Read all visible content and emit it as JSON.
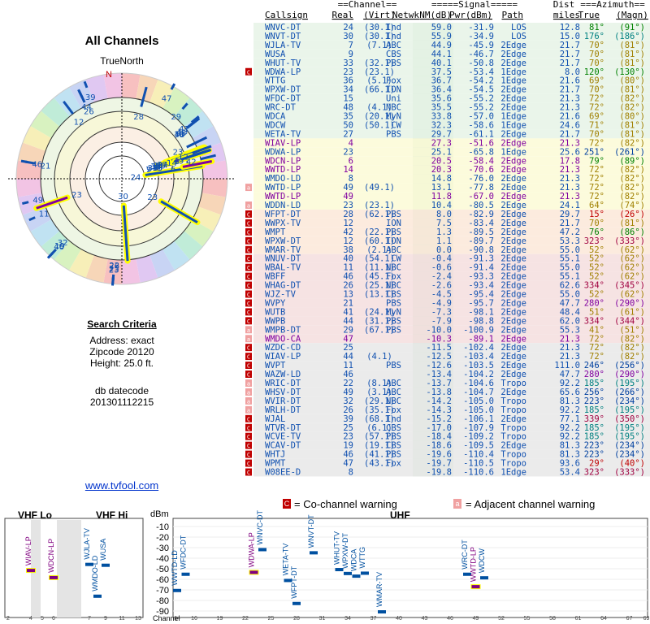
{
  "left": {
    "title": "All Channels",
    "north_label": "TrueNorth",
    "compass_n": "N",
    "search_heading": "Search Criteria",
    "address": "Address: exact",
    "zipcode": "Zipcode 20120",
    "height": "Height: 25.0 ft.",
    "db_label": "db datecode",
    "db_code": "201301112215",
    "link": "www.tvfool.com"
  },
  "table": {
    "group_headers": {
      "channel": "==Channel==",
      "signal": "=====Signal=====",
      "dist": "Dist",
      "azimuth": "===Azimuth=="
    },
    "columns": [
      "Callsign",
      "Real",
      "(Virt)",
      "Netwk",
      "NM(dB)",
      "Pwr(dBm)",
      "Path",
      "miles",
      "True",
      "(Magn)"
    ],
    "rows": [
      [
        "",
        "WNVC-DT",
        "24",
        "(30.1)",
        "Ind",
        "59.0",
        "-31.9",
        "LOS",
        "12.8",
        "81°",
        "(91°)"
      ],
      [
        "",
        "WNVT-DT",
        "30",
        "(30.1)",
        "Ind",
        "55.9",
        "-34.9",
        "LOS",
        "15.0",
        "176°",
        "(186°)"
      ],
      [
        "",
        "WJLA-TV",
        "7",
        "(7.1)",
        "ABC",
        "44.9",
        "-45.9",
        "2Edge",
        "21.7",
        "70°",
        "(81°)"
      ],
      [
        "",
        "WUSA",
        "9",
        "",
        "CBS",
        "44.1",
        "-46.7",
        "2Edge",
        "21.7",
        "70°",
        "(81°)"
      ],
      [
        "",
        "WHUT-TV",
        "33",
        "(32.1)",
        "PBS",
        "40.1",
        "-50.8",
        "2Edge",
        "21.7",
        "70°",
        "(81°)"
      ],
      [
        "C",
        "WDWA-LP",
        "23",
        "(23.1)",
        "",
        "37.5",
        "-53.4",
        "1Edge",
        "8.0",
        "120°",
        "(130°)"
      ],
      [
        "",
        "WTTG",
        "36",
        "(5.1)",
        "Fox",
        "36.7",
        "-54.2",
        "1Edge",
        "21.6",
        "69°",
        "(80°)"
      ],
      [
        "",
        "WPXW-DT",
        "34",
        "(66.1)",
        "ION",
        "36.4",
        "-54.5",
        "2Edge",
        "21.7",
        "70°",
        "(81°)"
      ],
      [
        "",
        "WFDC-DT",
        "15",
        "",
        "Uni",
        "35.6",
        "-55.2",
        "2Edge",
        "21.3",
        "72°",
        "(82°)"
      ],
      [
        "",
        "WRC-DT",
        "48",
        "(4.1)",
        "NBC",
        "35.5",
        "-55.2",
        "2Edge",
        "21.3",
        "72°",
        "(82°)"
      ],
      [
        "",
        "WDCA",
        "35",
        "(20.1)",
        "MyN",
        "33.8",
        "-57.0",
        "1Edge",
        "21.6",
        "69°",
        "(80°)"
      ],
      [
        "",
        "WDCW",
        "50",
        "(50.1)",
        "CW",
        "32.3",
        "-58.6",
        "1Edge",
        "24.6",
        "71°",
        "(81°)"
      ],
      [
        "",
        "WETA-TV",
        "27",
        "",
        "PBS",
        "29.7",
        "-61.1",
        "2Edge",
        "21.7",
        "70°",
        "(81°)"
      ],
      [
        "",
        "WIAV-LP",
        "4",
        "",
        "",
        "27.3",
        "-51.6",
        "2Edge",
        "21.3",
        "72°",
        "(82°)"
      ],
      [
        "",
        "WDWA-LP",
        "23",
        "",
        "",
        "25.1",
        "-65.8",
        "1Edge",
        "25.6",
        "251°",
        "(261°)"
      ],
      [
        "",
        "WDCN-LP",
        "6",
        "",
        "",
        "20.5",
        "-58.4",
        "2Edge",
        "17.8",
        "79°",
        "(89°)"
      ],
      [
        "",
        "WWTD-LP",
        "14",
        "",
        "",
        "20.3",
        "-70.6",
        "2Edge",
        "21.3",
        "72°",
        "(82°)"
      ],
      [
        "",
        "WMDO-LD",
        "8",
        "",
        "",
        "14.8",
        "-76.0",
        "2Edge",
        "21.3",
        "72°",
        "(82°)"
      ],
      [
        "a",
        "WWTD-LP",
        "49",
        "(49.1)",
        "",
        "13.1",
        "-77.8",
        "2Edge",
        "21.3",
        "72°",
        "(82°)"
      ],
      [
        "",
        "WWTD-LP",
        "49",
        "",
        "",
        "11.8",
        "-67.0",
        "2Edge",
        "21.3",
        "72°",
        "(82°)"
      ],
      [
        "a",
        "WDDN-LD",
        "23",
        "(23.1)",
        "",
        "10.4",
        "-80.5",
        "2Edge",
        "24.1",
        "64°",
        "(74°)"
      ],
      [
        "C",
        "WFPT-DT",
        "28",
        "(62.1)",
        "PBS",
        "8.0",
        "-82.9",
        "2Edge",
        "29.7",
        "15°",
        "(26°)"
      ],
      [
        "C",
        "WWPX-TV",
        "12",
        "",
        "ION",
        "7.5",
        "-83.4",
        "2Edge",
        "21.7",
        "70°",
        "(81°)"
      ],
      [
        "C",
        "WMPT",
        "42",
        "(22.1)",
        "PBS",
        "1.3",
        "-89.5",
        "2Edge",
        "47.2",
        "76°",
        "(86°)"
      ],
      [
        "C",
        "WPXW-DT",
        "12",
        "(60.1)",
        "ION",
        "1.1",
        "-89.7",
        "2Edge",
        "53.3",
        "323°",
        "(333°)"
      ],
      [
        "C",
        "WMAR-TV",
        "38",
        "(2.1)",
        "ABC",
        "0.0",
        "-90.8",
        "2Edge",
        "55.0",
        "52°",
        "(62°)"
      ],
      [
        "C",
        "WNUV-DT",
        "40",
        "(54.1)",
        "CW",
        "-0.4",
        "-91.3",
        "2Edge",
        "55.1",
        "52°",
        "(62°)"
      ],
      [
        "C",
        "WBAL-TV",
        "11",
        "(11.1)",
        "NBC",
        "-0.6",
        "-91.4",
        "2Edge",
        "55.0",
        "52°",
        "(62°)"
      ],
      [
        "C",
        "WBFF",
        "46",
        "(45.1)",
        "Fox",
        "-2.4",
        "-93.3",
        "2Edge",
        "55.1",
        "52°",
        "(62°)"
      ],
      [
        "C",
        "WHAG-DT",
        "26",
        "(25.1)",
        "NBC",
        "-2.6",
        "-93.4",
        "2Edge",
        "62.6",
        "334°",
        "(345°)"
      ],
      [
        "C",
        "WJZ-TV",
        "13",
        "(13.1)",
        "CBS",
        "-4.5",
        "-95.4",
        "2Edge",
        "55.0",
        "52°",
        "(62°)"
      ],
      [
        "C",
        "WVPY",
        "21",
        "",
        "PBS",
        "-4.9",
        "-95.7",
        "2Edge",
        "47.7",
        "280°",
        "(290°)"
      ],
      [
        "C",
        "WUTB",
        "41",
        "(24.1)",
        "MyN",
        "-7.3",
        "-98.1",
        "2Edge",
        "48.4",
        "51°",
        "(61°)"
      ],
      [
        "C",
        "WWPB",
        "44",
        "(31.1)",
        "PBS",
        "-7.9",
        "-98.8",
        "2Edge",
        "62.0",
        "334°",
        "(344°)"
      ],
      [
        "a",
        "WMPB-DT",
        "29",
        "(67.1)",
        "PBS",
        "-10.0",
        "-100.9",
        "2Edge",
        "55.3",
        "41°",
        "(51°)"
      ],
      [
        "a",
        "WMDO-CA",
        "47",
        "",
        "",
        "-10.3",
        "-89.1",
        "2Edge",
        "21.3",
        "72°",
        "(82°)"
      ],
      [
        "C",
        "WZDC-CD",
        "25",
        "",
        "",
        "-11.5",
        "-102.4",
        "2Edge",
        "21.3",
        "72°",
        "(82°)"
      ],
      [
        "C",
        "WIAV-LP",
        "44",
        "(4.1)",
        "",
        "-12.5",
        "-103.4",
        "2Edge",
        "21.3",
        "72°",
        "(82°)"
      ],
      [
        "C",
        "WVPT",
        "11",
        "",
        "PBS",
        "-12.6",
        "-103.5",
        "2Edge",
        "111.0",
        "246°",
        "(256°)"
      ],
      [
        "C",
        "WAZW-LD",
        "46",
        "",
        "",
        "-13.4",
        "-104.2",
        "2Edge",
        "47.7",
        "280°",
        "(290°)"
      ],
      [
        "a",
        "WRIC-DT",
        "22",
        "(8.1)",
        "ABC",
        "-13.7",
        "-104.6",
        "Tropo",
        "92.2",
        "185°",
        "(195°)"
      ],
      [
        "a",
        "WHSV-DT",
        "49",
        "(3.1)",
        "ABC",
        "-13.8",
        "-104.7",
        "2Edge",
        "65.6",
        "256°",
        "(266°)"
      ],
      [
        "a",
        "WVIR-DT",
        "32",
        "(29.1)",
        "NBC",
        "-14.2",
        "-105.0",
        "Tropo",
        "81.3",
        "223°",
        "(234°)"
      ],
      [
        "a",
        "WRLH-DT",
        "26",
        "(35.1)",
        "Fox",
        "-14.3",
        "-105.0",
        "Tropo",
        "92.2",
        "185°",
        "(195°)"
      ],
      [
        "C",
        "WJAL",
        "39",
        "(68.1)",
        "Ind",
        "-15.2",
        "-106.1",
        "2Edge",
        "77.1",
        "339°",
        "(350°)"
      ],
      [
        "C",
        "WTVR-DT",
        "25",
        "(6.1)",
        "CBS",
        "-17.0",
        "-107.9",
        "Tropo",
        "92.2",
        "185°",
        "(195°)"
      ],
      [
        "C",
        "WCVE-TV",
        "23",
        "(57.1)",
        "PBS",
        "-18.4",
        "-109.2",
        "Tropo",
        "92.2",
        "185°",
        "(195°)"
      ],
      [
        "C",
        "WCAV-DT",
        "19",
        "(19.1)",
        "CBS",
        "-18.6",
        "-109.5",
        "2Edge",
        "81.3",
        "223°",
        "(234°)"
      ],
      [
        "C",
        "WHTJ",
        "46",
        "(41.1)",
        "PBS",
        "-19.6",
        "-110.4",
        "Tropo",
        "81.3",
        "223°",
        "(234°)"
      ],
      [
        "C",
        "WPMT",
        "47",
        "(43.1)",
        "Fox",
        "-19.7",
        "-110.5",
        "Tropo",
        "93.6",
        "29°",
        "(40°)"
      ],
      [
        "C",
        "W08EE-D",
        "8",
        "",
        "",
        "-19.8",
        "-110.6",
        "1Edge",
        "53.4",
        "323°",
        "(333°)"
      ]
    ]
  },
  "legend": {
    "co_icon": "C",
    "co_text": "= Co-channel warning",
    "adj_icon": "a",
    "adj_text": "= Adjacent channel warning"
  },
  "bottom_chart": {
    "vhf_lo": "VHF Lo",
    "vhf_hi": "VHF Hi",
    "uhf": "UHF",
    "dbm": "dBm",
    "channel_label": "Channel"
  },
  "chart_data": [
    {
      "type": "scatter",
      "title": "All Channels",
      "xlabel": "",
      "ylabel": "",
      "description_of_axes": "polar azimuth degrees vs signal margin",
      "points": [
        {
          "label": "24",
          "azimuth": 81,
          "nm": 59.0
        },
        {
          "label": "30",
          "azimuth": 176,
          "nm": 55.9
        },
        {
          "label": "7",
          "azimuth": 70,
          "nm": 44.9
        },
        {
          "label": "9",
          "azimuth": 70,
          "nm": 44.1
        },
        {
          "label": "33",
          "azimuth": 70,
          "nm": 40.1
        },
        {
          "label": "23",
          "azimuth": 120,
          "nm": 37.5
        },
        {
          "label": "36",
          "azimuth": 69,
          "nm": 36.7
        },
        {
          "label": "34",
          "azimuth": 70,
          "nm": 36.4
        },
        {
          "label": "15",
          "azimuth": 72,
          "nm": 35.6
        },
        {
          "label": "48",
          "azimuth": 72,
          "nm": 35.5
        },
        {
          "label": "35",
          "azimuth": 69,
          "nm": 33.8
        },
        {
          "label": "50",
          "azimuth": 71,
          "nm": 32.3
        },
        {
          "label": "27",
          "azimuth": 70,
          "nm": 29.7
        },
        {
          "label": "4",
          "azimuth": 72,
          "nm": 27.3
        },
        {
          "label": "23",
          "azimuth": 251,
          "nm": 25.1
        },
        {
          "label": "6",
          "azimuth": 79,
          "nm": 20.5
        },
        {
          "label": "14",
          "azimuth": 72,
          "nm": 20.3
        },
        {
          "label": "8",
          "azimuth": 72,
          "nm": 14.8
        },
        {
          "label": "49",
          "azimuth": 72,
          "nm": 13.1
        },
        {
          "label": "23",
          "azimuth": 64,
          "nm": 10.4
        },
        {
          "label": "28",
          "azimuth": 15,
          "nm": 8.0
        },
        {
          "label": "12",
          "azimuth": 70,
          "nm": 7.5
        },
        {
          "label": "42",
          "azimuth": 76,
          "nm": 1.3
        },
        {
          "label": "12",
          "azimuth": 323,
          "nm": 1.1
        },
        {
          "label": "38",
          "azimuth": 52,
          "nm": 0.0
        },
        {
          "label": "40",
          "azimuth": 52,
          "nm": -0.4
        },
        {
          "label": "11",
          "azimuth": 52,
          "nm": -0.6
        },
        {
          "label": "46",
          "azimuth": 52,
          "nm": -2.4
        },
        {
          "label": "26",
          "azimuth": 334,
          "nm": -2.6
        },
        {
          "label": "13",
          "azimuth": 52,
          "nm": -4.5
        },
        {
          "label": "21",
          "azimuth": 280,
          "nm": -4.9
        },
        {
          "label": "41",
          "azimuth": 51,
          "nm": -7.3
        },
        {
          "label": "44",
          "azimuth": 334,
          "nm": -7.9
        },
        {
          "label": "29",
          "azimuth": 41,
          "nm": -10.0
        },
        {
          "label": "11",
          "azimuth": 246,
          "nm": -12.6
        },
        {
          "label": "46",
          "azimuth": 280,
          "nm": -13.4
        },
        {
          "label": "22",
          "azimuth": 185,
          "nm": -13.7
        },
        {
          "label": "49",
          "azimuth": 256,
          "nm": -13.8
        },
        {
          "label": "32",
          "azimuth": 223,
          "nm": -14.2
        },
        {
          "label": "26",
          "azimuth": 185,
          "nm": -14.3
        },
        {
          "label": "39",
          "azimuth": 339,
          "nm": -15.2
        },
        {
          "label": "25",
          "azimuth": 185,
          "nm": -17.0
        },
        {
          "label": "23",
          "azimuth": 185,
          "nm": -18.4
        },
        {
          "label": "19",
          "azimuth": 223,
          "nm": -18.6
        },
        {
          "label": "46",
          "azimuth": 223,
          "nm": -19.6
        },
        {
          "label": "47",
          "azimuth": 29,
          "nm": -19.7
        }
      ]
    },
    {
      "type": "bar",
      "title": "",
      "ylabel": "dBm",
      "ylim": [
        -90,
        -10
      ],
      "y_ticks": [
        -10,
        -20,
        -30,
        -40,
        -50,
        -60,
        -70,
        -80,
        -90
      ],
      "x_ticks": [
        "2",
        "4",
        "5",
        "6",
        "7",
        "9",
        "11",
        "13",
        "14",
        "16",
        "19",
        "22",
        "25",
        "28",
        "31",
        "34",
        "37",
        "40",
        "43",
        "46",
        "49",
        "52",
        "55",
        "58",
        "61",
        "64",
        "67",
        "69"
      ],
      "stations": [
        {
          "call": "WIAV-LP",
          "ch": 4,
          "dbm": -51.6,
          "color": "#800080"
        },
        {
          "call": "WDCN-LP",
          "ch": 6,
          "dbm": -58.4,
          "color": "#800080"
        },
        {
          "call": "WJLA-TV",
          "ch": 7,
          "dbm": -45.9,
          "color": "#0050a0"
        },
        {
          "call": "WMDO-LD",
          "ch": 8,
          "dbm": -76.0,
          "color": "#0050a0"
        },
        {
          "call": "WUSA",
          "ch": 9,
          "dbm": -46.7,
          "color": "#0050a0"
        },
        {
          "call": "WWTD-LD",
          "ch": 14,
          "dbm": -70.6,
          "color": "#0050a0"
        },
        {
          "call": "WFDC-DT",
          "ch": 15,
          "dbm": -55.2,
          "color": "#0050a0"
        },
        {
          "call": "WDWA-LP",
          "ch": 23,
          "dbm": -53.4,
          "color": "#800080"
        },
        {
          "call": "WNVC-DT",
          "ch": 24,
          "dbm": -31.9,
          "color": "#0050a0"
        },
        {
          "call": "WETA-TV",
          "ch": 27,
          "dbm": -61.1,
          "color": "#0050a0"
        },
        {
          "call": "WFPT-DT",
          "ch": 28,
          "dbm": -82.9,
          "color": "#0050a0"
        },
        {
          "call": "WNVT-DT",
          "ch": 30,
          "dbm": -34.9,
          "color": "#0050a0"
        },
        {
          "call": "WHUT-TV",
          "ch": 33,
          "dbm": -50.8,
          "color": "#0050a0"
        },
        {
          "call": "WPXW-DT",
          "ch": 34,
          "dbm": -54.5,
          "color": "#0050a0"
        },
        {
          "call": "WDCA",
          "ch": 35,
          "dbm": -57.0,
          "color": "#0050a0"
        },
        {
          "call": "WTTG",
          "ch": 36,
          "dbm": -54.2,
          "color": "#0050a0"
        },
        {
          "call": "WMAR-TV",
          "ch": 38,
          "dbm": -90.8,
          "color": "#0050a0"
        },
        {
          "call": "WRC-DT",
          "ch": 48,
          "dbm": -55.2,
          "color": "#0050a0"
        },
        {
          "call": "WWTD-LP",
          "ch": 49,
          "dbm": -67.0,
          "color": "#800080"
        },
        {
          "call": "WDCW",
          "ch": 50,
          "dbm": -58.6,
          "color": "#0050a0"
        }
      ]
    }
  ]
}
